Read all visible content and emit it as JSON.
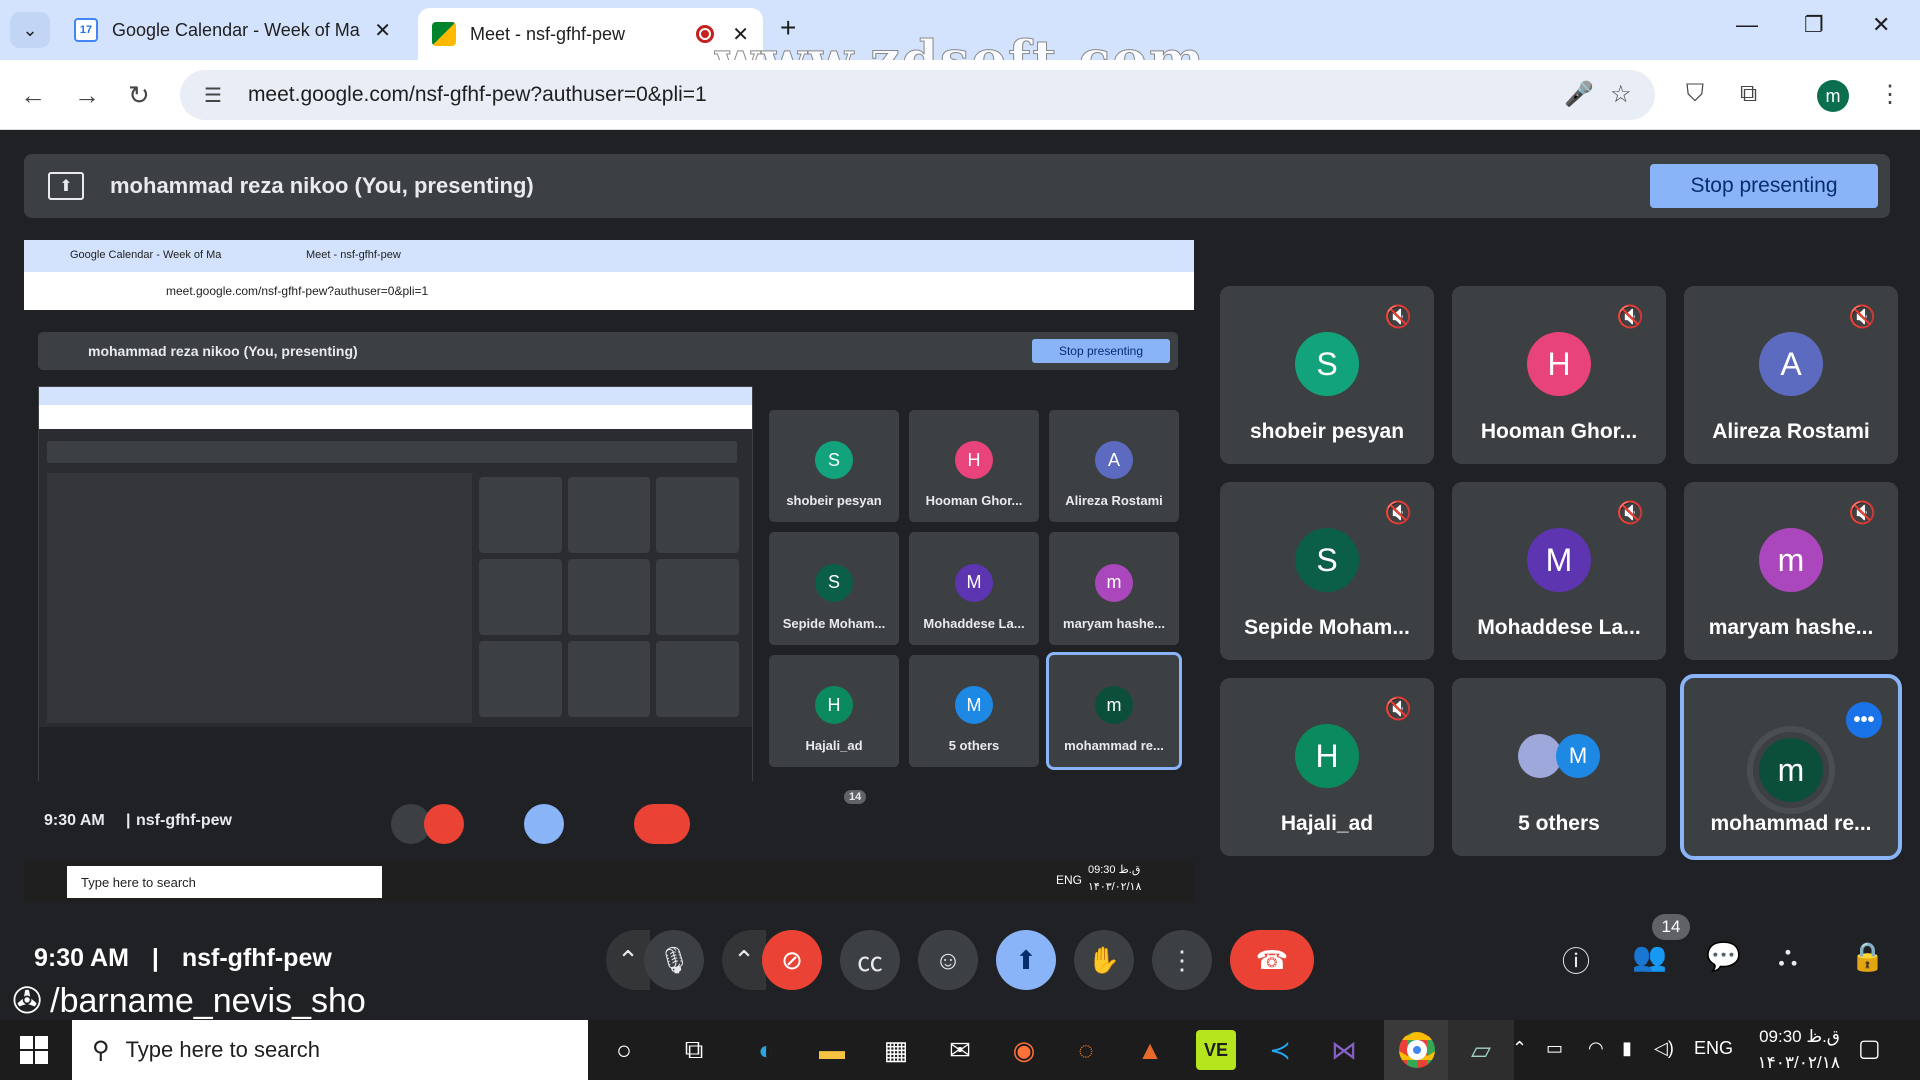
{
  "browser": {
    "tabs": [
      {
        "title": "Google Calendar - Week of Ma",
        "icon": "calendar-icon",
        "favicon_text": "17"
      },
      {
        "title": "Meet - nsf-gfhf-pew",
        "icon": "meet-icon"
      }
    ],
    "url": "meet.google.com/nsf-gfhf-pew?authuser=0&pli=1",
    "profile_initial": "m",
    "watermark": "www.zdsoft.com"
  },
  "meet": {
    "presenting_text": "mohammad reza nikoo (You, presenting)",
    "stop_label": "Stop presenting",
    "time": "9:30 AM",
    "separator": "|",
    "meeting_code": "nsf-gfhf-pew",
    "participants_count": "14",
    "participants": [
      {
        "name": "shobeir pesyan",
        "initial": "S",
        "color": "#12a37c",
        "muted": true
      },
      {
        "name": "Hooman Ghor...",
        "initial": "H",
        "color": "#e8437a",
        "muted": true
      },
      {
        "name": "Alireza Rostami",
        "initial": "A",
        "color": "#5c6bc0",
        "muted": true
      },
      {
        "name": "Sepide Moham...",
        "initial": "S",
        "color": "#0b5e48",
        "muted": true
      },
      {
        "name": "Mohaddese La...",
        "initial": "M",
        "color": "#5e35b1",
        "muted": true
      },
      {
        "name": "maryam hashe...",
        "initial": "m",
        "color": "#ab47bc",
        "muted": true
      },
      {
        "name": "Hajali_ad",
        "initial": "H",
        "color": "#0b8a5f",
        "muted": true
      },
      {
        "name": "5 others",
        "initial": "M",
        "color": "#1e88e5",
        "muted": false
      },
      {
        "name": "mohammad re...",
        "initial": "m",
        "color": "#0b4f3a",
        "muted": false
      }
    ]
  },
  "overlay": {
    "channel": "/barname_nevis_sho"
  },
  "taskbar": {
    "search_placeholder": "Type here to search",
    "language": "ENG",
    "clock_time": "09:30 ق.ظ",
    "clock_date": "۱۴۰۳/۰۲/۱۸"
  },
  "nested": {
    "tab1": "Google Calendar - Week of Ma",
    "tab2": "Meet - nsf-gfhf-pew",
    "url": "meet.google.com/nsf-gfhf-pew?authuser=0&pli=1",
    "presenting_text": "mohammad reza nikoo (You, presenting)",
    "stop_label": "Stop presenting",
    "time": "9:30 AM",
    "meeting_code": "nsf-gfhf-pew",
    "search_placeholder": "Type here to search",
    "language": "ENG",
    "clock_time": "09:30 ق.ظ",
    "clock_date": "۱۴۰۳/۰۲/۱۸",
    "count": "14"
  }
}
